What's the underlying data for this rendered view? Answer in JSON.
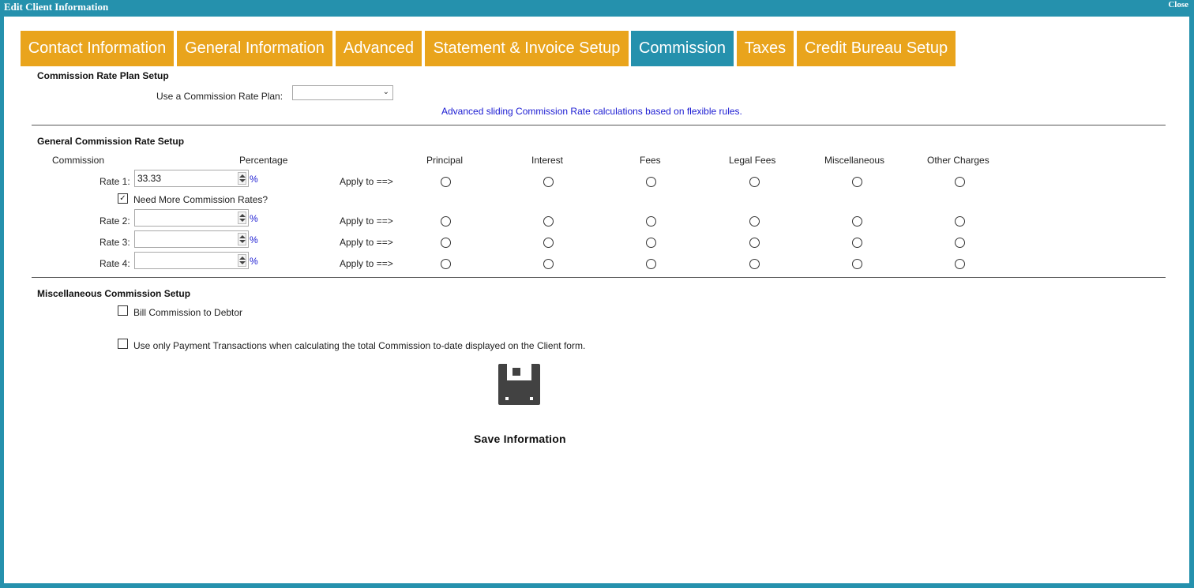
{
  "window": {
    "title": "Edit Client Information",
    "close_label": "Close"
  },
  "tabs": [
    {
      "label": "Contact Information"
    },
    {
      "label": "General Information"
    },
    {
      "label": "Advanced"
    },
    {
      "label": "Statement & Invoice Setup"
    },
    {
      "label": "Commission",
      "active": true
    },
    {
      "label": "Taxes"
    },
    {
      "label": "Credit Bureau Setup"
    }
  ],
  "plan_setup": {
    "title": "Commission Rate Plan Setup",
    "use_plan_label": "Use a Commission Rate Plan:",
    "selected_plan": "",
    "advanced_link": "Advanced sliding Commission Rate calculations based on flexible rules."
  },
  "general_setup": {
    "title": "General Commission Rate Setup",
    "headers": {
      "commission": "Commission",
      "percentage": "Percentage",
      "principal": "Principal",
      "interest": "Interest",
      "fees": "Fees",
      "legal_fees": "Legal Fees",
      "miscellaneous": "Miscellaneous",
      "other_charges": "Other Charges"
    },
    "percent_symbol": "%",
    "apply_label": "Apply to ==>",
    "need_more_label": "Need More Commission Rates?",
    "need_more_checked": true,
    "rates": [
      {
        "label": "Rate 1:",
        "value": "33.33"
      },
      {
        "label": "Rate 2:",
        "value": ""
      },
      {
        "label": "Rate 3:",
        "value": ""
      },
      {
        "label": "Rate 4:",
        "value": ""
      }
    ]
  },
  "misc_setup": {
    "title": "Miscellaneous Commission Setup",
    "bill_to_debtor_label": "Bill Commission to Debtor",
    "bill_to_debtor_checked": false,
    "payment_only_label": "Use only Payment Transactions when calculating the total Commission to-date displayed on the Client form.",
    "payment_only_checked": false
  },
  "save": {
    "label": "Save Information",
    "icon": "floppy-disk-icon"
  },
  "colors": {
    "frame": "#2591ad",
    "tab": "#e9a41c",
    "tab_active": "#2591ad",
    "link": "#1a1ad2"
  }
}
